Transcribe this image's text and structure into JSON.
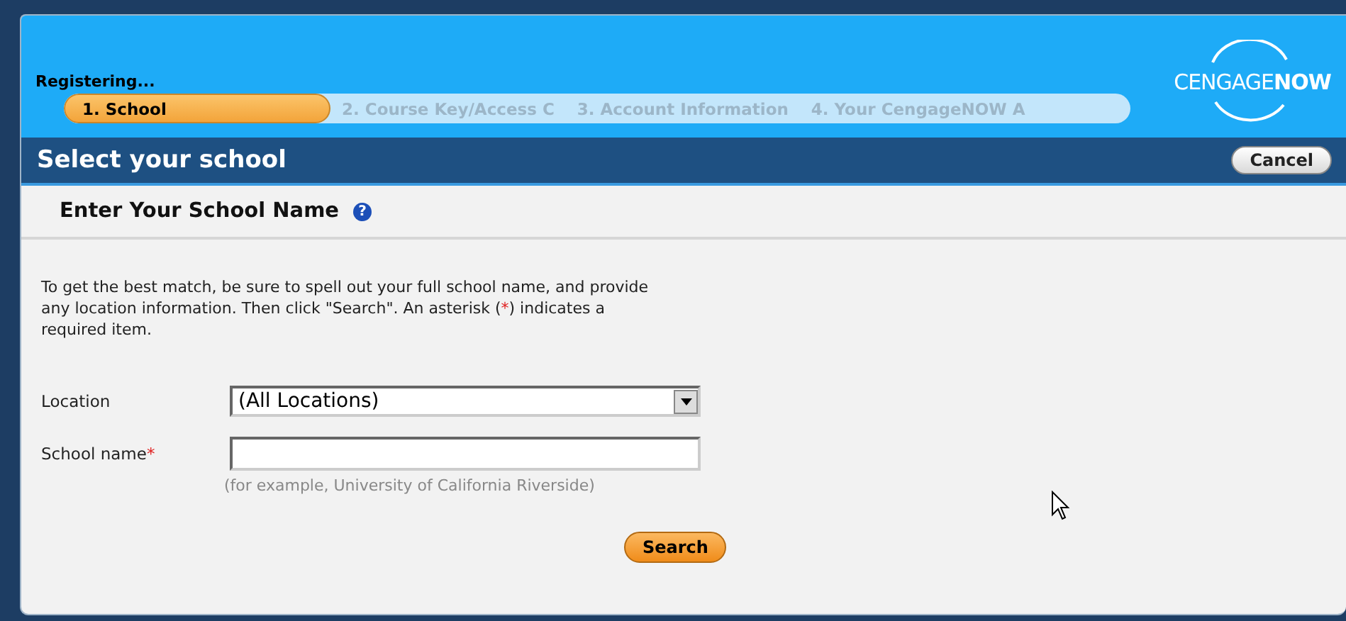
{
  "header": {
    "status": "Registering...",
    "logo": "CENGAGE**NOW**"
  },
  "steps": [
    {
      "label": "1. School",
      "selected": true
    },
    {
      "label": "2. Course Key/Access C",
      "selected": false
    },
    {
      "label": "3. Account Information",
      "selected": false
    },
    {
      "label": "4. Your CengageNOW A",
      "selected": false
    }
  ],
  "title_bar": {
    "title": "Select your school",
    "cancel": "Cancel"
  },
  "section": {
    "heading": "Enter Your School Name",
    "help": "?"
  },
  "intro": {
    "before": "To get the best match, be sure to spell out your full school name, and provide any location information. Then click \"Search\". An asterisk (",
    "mark": "*",
    "after": ") indicates a required item."
  },
  "fields": [
    {
      "kind": "select",
      "label": "Location",
      "required": false,
      "value": "(All Locations)"
    },
    {
      "kind": "text",
      "label": "School name",
      "required": true,
      "hint": "(for example, University of California Riverside)"
    }
  ],
  "required_mark": "*",
  "search_button": "Search"
}
